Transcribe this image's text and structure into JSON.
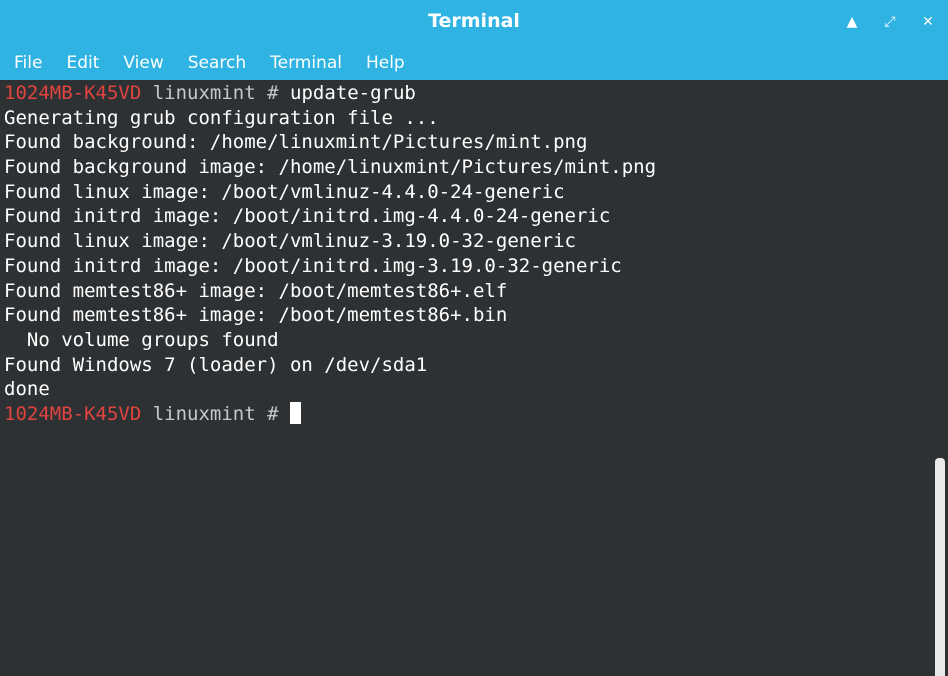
{
  "window": {
    "title": "Terminal",
    "controls": {
      "minimize_icon": "▲",
      "maximize_icon": "⤢",
      "close_icon": "✕"
    }
  },
  "menu": {
    "file": "File",
    "edit": "Edit",
    "view": "View",
    "search": "Search",
    "terminal": "Terminal",
    "help": "Help"
  },
  "prompt": {
    "host": "1024MB-K45VD",
    "user_dir": " linuxmint # ",
    "command": "update-grub"
  },
  "output": [
    "Generating grub configuration file ...",
    "Found background: /home/linuxmint/Pictures/mint.png",
    "Found background image: /home/linuxmint/Pictures/mint.png",
    "Found linux image: /boot/vmlinuz-4.4.0-24-generic",
    "Found initrd image: /boot/initrd.img-4.4.0-24-generic",
    "Found linux image: /boot/vmlinuz-3.19.0-32-generic",
    "Found initrd image: /boot/initrd.img-3.19.0-32-generic",
    "Found memtest86+ image: /boot/memtest86+.elf",
    "Found memtest86+ image: /boot/memtest86+.bin",
    "  No volume groups found",
    "Found Windows 7 (loader) on /dev/sda1",
    "done"
  ],
  "colors": {
    "titlebar": "#2fb3e2",
    "terminal_bg": "#2e3133",
    "prompt_host": "#e0443e",
    "text": "#ffffff"
  }
}
